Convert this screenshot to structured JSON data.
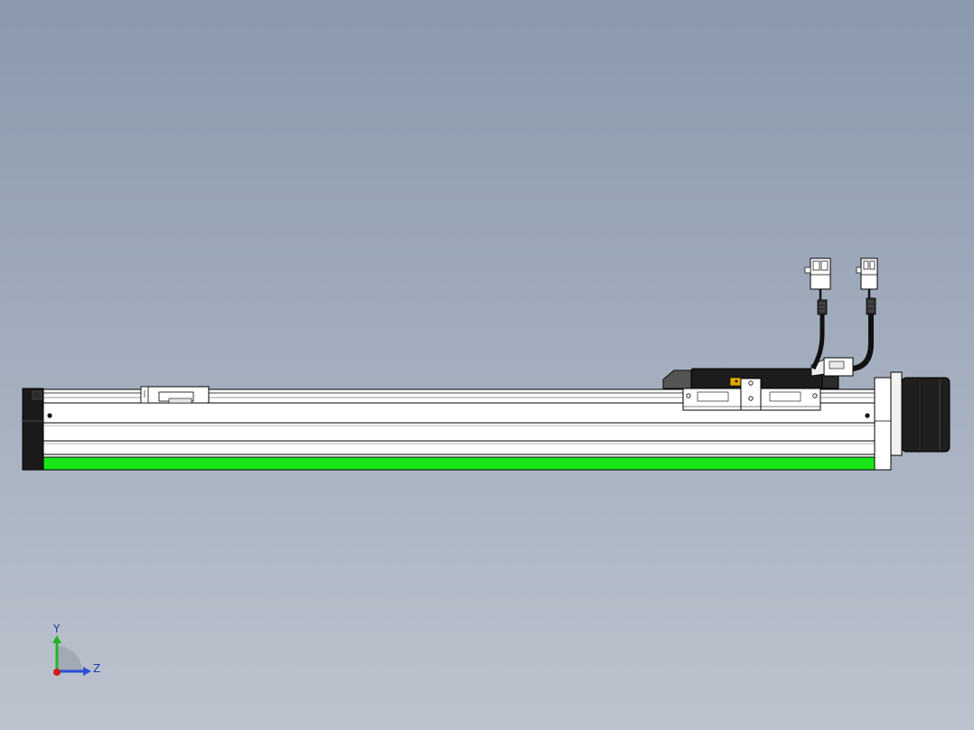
{
  "viewport": {
    "background_top": "#8a99ad",
    "background_bottom": "#bcc3ce"
  },
  "model": {
    "accent_stripe_color": "#19e619",
    "body_color": "#ffffff",
    "motor_color": "#1e1e1e",
    "marker_color": "#e0a800"
  },
  "triad": {
    "y_label": "Y",
    "z_label": "Z",
    "y_color": "#21b521",
    "z_color": "#2a4fd6",
    "origin_color": "#d01b1b"
  }
}
